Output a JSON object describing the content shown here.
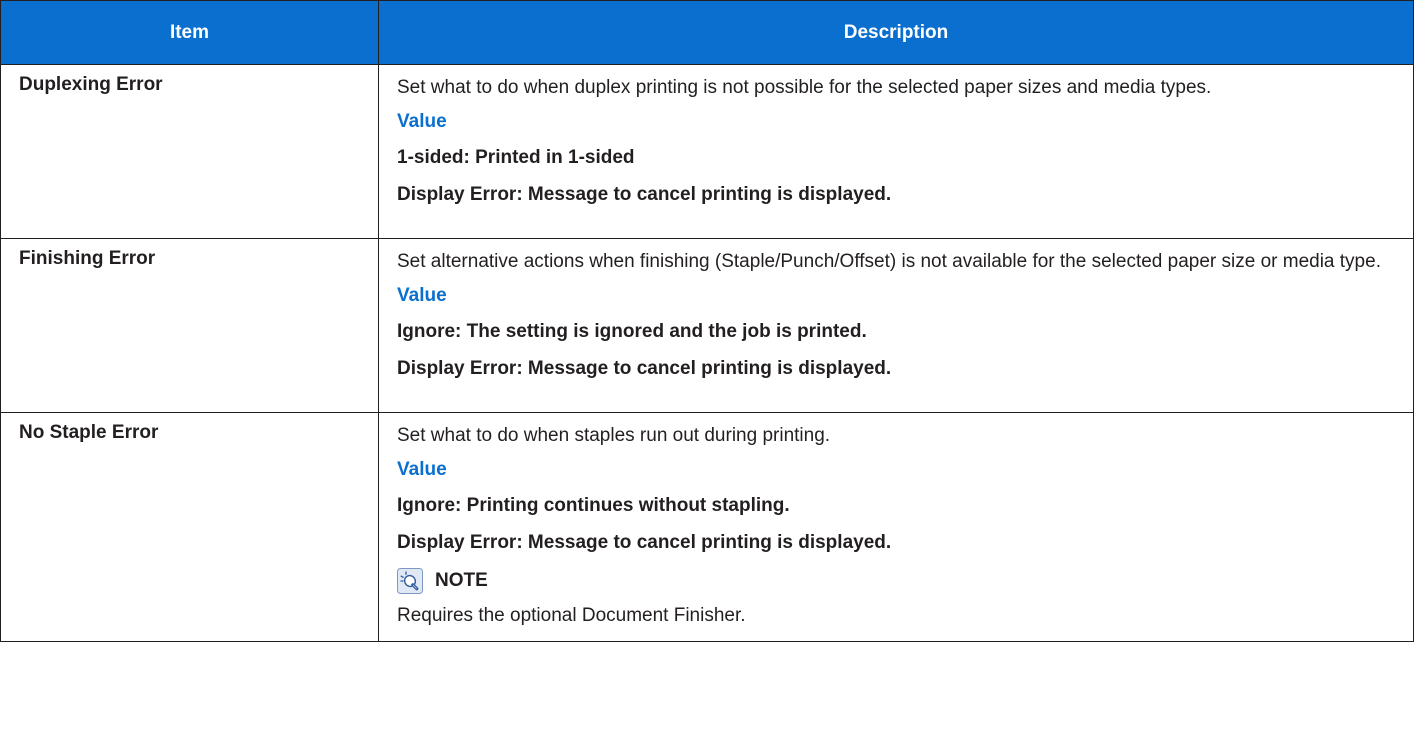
{
  "header": {
    "item_col": "Item",
    "description_col": "Description"
  },
  "rows": [
    {
      "item": "Duplexing Error",
      "description": "Set what to do when duplex printing is not possible for the selected paper sizes and media types.",
      "value_heading": "Value",
      "values": [
        "1-sided: Printed in 1-sided",
        "Display Error: Message to cancel printing is displayed."
      ]
    },
    {
      "item": "Finishing Error",
      "description": "Set alternative actions when finishing (Staple/Punch/Offset) is not available for the selected paper size or media type.",
      "value_heading": "Value",
      "values": [
        "Ignore: The setting is ignored and the job is printed.",
        "Display Error: Message to cancel printing is displayed."
      ]
    },
    {
      "item": "No Staple Error",
      "description": "Set what to do when staples run out during printing.",
      "value_heading": "Value",
      "values": [
        "Ignore: Printing continues without stapling.",
        "Display Error: Message to cancel printing is displayed."
      ],
      "note": {
        "label": "NOTE",
        "icon": "note-lightbulb-icon",
        "text": "Requires the optional Document Finisher."
      }
    }
  ],
  "colors": {
    "header_bg": "#0a6fcf",
    "value_heading": "#0a6fcf",
    "text": "#231f20"
  }
}
